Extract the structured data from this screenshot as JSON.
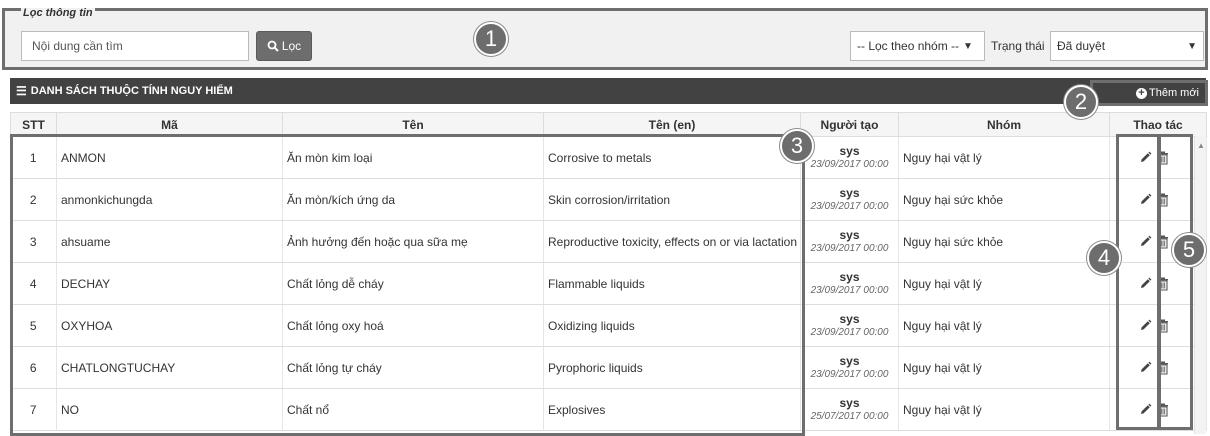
{
  "filter": {
    "legend": "Lọc thông tin",
    "search_placeholder": "Nội dung cần tìm",
    "filter_button": "Lọc",
    "group_select": "-- Lọc theo nhóm --",
    "status_label": "Trạng thái",
    "status_select": "Đã duyệt"
  },
  "list": {
    "title": "DANH SÁCH THUỘC TÍNH NGUY HIỂM",
    "add_button": "Thêm mới",
    "columns": [
      "STT",
      "Mã",
      "Tên",
      "Tên (en)",
      "Người tạo",
      "Nhóm",
      "Thao tác"
    ],
    "rows": [
      {
        "stt": "1",
        "code": "ANMON",
        "name": "Ăn mòn kim loại",
        "name_en": "Corrosive to metals",
        "creator": "sys",
        "created": "23/09/2017 00:00",
        "group": "Nguy hại vật lý"
      },
      {
        "stt": "2",
        "code": "anmonkichungda",
        "name": "Ăn mòn/kích ứng da",
        "name_en": "Skin corrosion/irritation",
        "creator": "sys",
        "created": "23/09/2017 00:00",
        "group": "Nguy hại sức khỏe"
      },
      {
        "stt": "3",
        "code": "ahsuame",
        "name": "Ảnh hưởng đến hoặc qua sữa mẹ",
        "name_en": "Reproductive toxicity, effects on or via lactation",
        "creator": "sys",
        "created": "23/09/2017 00:00",
        "group": "Nguy hại sức khỏe"
      },
      {
        "stt": "4",
        "code": "DECHAY",
        "name": "Chất lỏng dễ cháy",
        "name_en": "Flammable liquids",
        "creator": "sys",
        "created": "23/09/2017 00:00",
        "group": "Nguy hại vật lý"
      },
      {
        "stt": "5",
        "code": "OXYHOA",
        "name": "Chất lỏng oxy hoá",
        "name_en": "Oxidizing liquids",
        "creator": "sys",
        "created": "23/09/2017 00:00",
        "group": "Nguy hại vật lý"
      },
      {
        "stt": "6",
        "code": "CHATLONGTUCHAY",
        "name": "Chất lỏng tự cháy",
        "name_en": "Pyrophoric liquids",
        "creator": "sys",
        "created": "23/09/2017 00:00",
        "group": "Nguy hại vật lý"
      },
      {
        "stt": "7",
        "code": "NO",
        "name": "Chất nổ",
        "name_en": "Explosives",
        "creator": "sys",
        "created": "25/07/2017 00:00",
        "group": "Nguy hại vật lý"
      }
    ]
  },
  "callouts": [
    "1",
    "2",
    "3",
    "4",
    "5"
  ],
  "icons": {
    "search": "search-icon",
    "menu": "list-icon",
    "add": "plus-circle-icon",
    "edit": "pencil-icon",
    "delete": "trash-icon",
    "dropdown": "caret-down-icon"
  },
  "colors": {
    "header_bg": "#424242",
    "button_bg": "#6d6d6d",
    "frame": "#6e6e6e",
    "filter_bg": "#f1f1f1"
  }
}
